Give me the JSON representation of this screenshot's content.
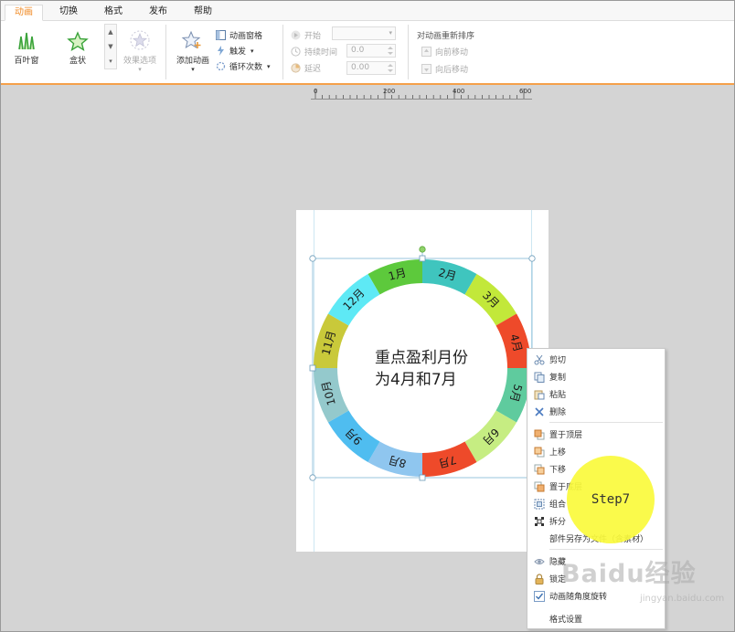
{
  "tabs": [
    "动画",
    "切换",
    "格式",
    "发布",
    "帮助"
  ],
  "ribbon": {
    "effects": [
      "百叶窗",
      "盒状"
    ],
    "effect_options": "效果选项",
    "add_animation": "添加动画",
    "animation_pane": "动画窗格",
    "trigger": "触发",
    "loop_count": "循环次数",
    "start_label": "开始",
    "duration_label": "持续时间",
    "duration_value": "0.0",
    "delay_label": "延迟",
    "delay_value": "0.00",
    "reorder_title": "对动画重新排序",
    "move_earlier": "向前移动",
    "move_later": "向后移动"
  },
  "ruler": {
    "ticks": [
      "0",
      "200",
      "400",
      "600"
    ]
  },
  "slide": {
    "center_line1": "重点盈利月份",
    "center_line2": "为4月和7月",
    "months": [
      "1月",
      "2月",
      "3月",
      "4月",
      "5月",
      "6月",
      "7月",
      "8月",
      "9月",
      "10月",
      "11月",
      "12月"
    ],
    "segment_colors": [
      "#5dc93c",
      "#3fc5be",
      "#c2e83a",
      "#ee4a2a",
      "#5fcb9e",
      "#c6ed82",
      "#ee4a2a",
      "#8fc6ef",
      "#4fbdf0",
      "#94c9cc",
      "#c9c93a",
      "#5ee9f5"
    ]
  },
  "context_menu": {
    "items": [
      "剪切",
      "复制",
      "粘贴",
      "删除",
      "置于顶层",
      "上移",
      "下移",
      "置于底层",
      "组合",
      "拆分",
      "部件另存为文件（含素材）",
      "隐藏",
      "锁定",
      "动画随角度旋转",
      "格式设置"
    ]
  },
  "step_badge": "Step7",
  "watermark": "Baidu经验",
  "watermark_sub": "jingyan.baidu.com"
}
